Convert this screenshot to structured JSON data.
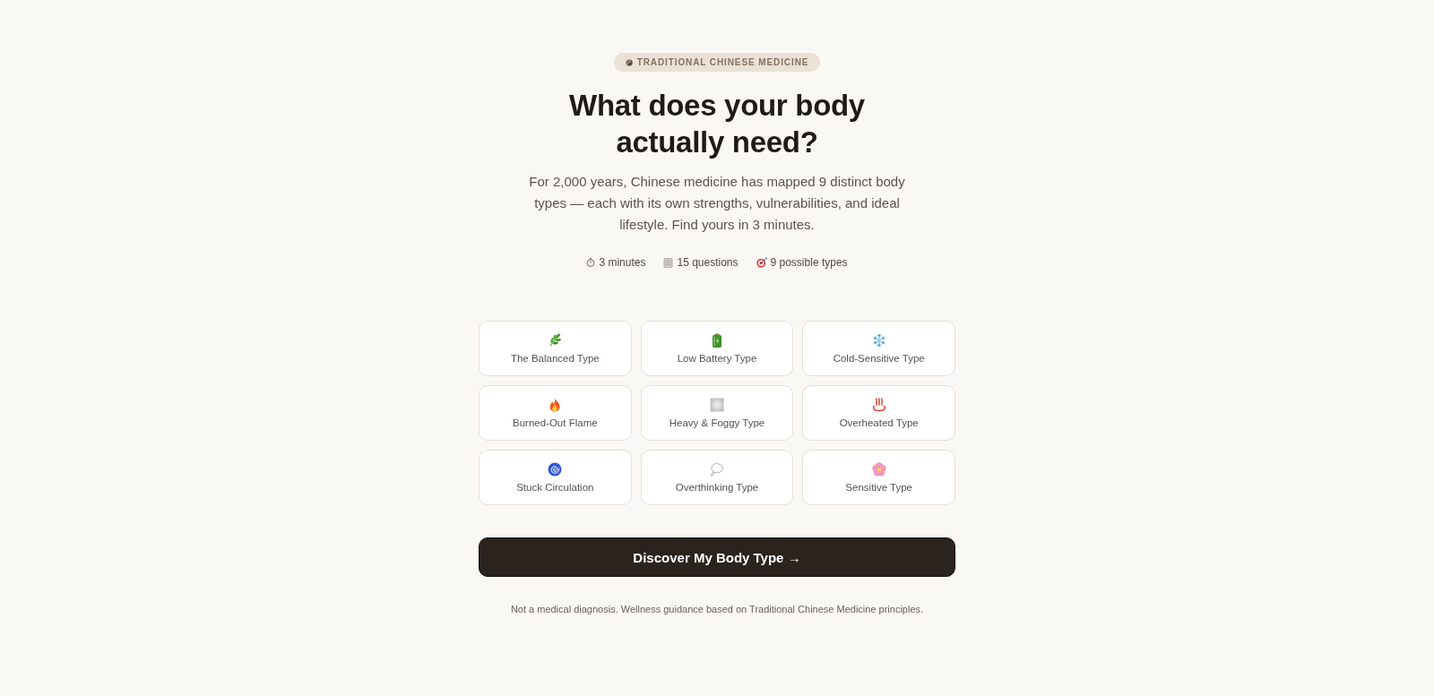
{
  "badge": {
    "label": "TRADITIONAL CHINESE MEDICINE"
  },
  "title": "What does your body actually need?",
  "intro": "For 2,000 years, Chinese medicine has mapped 9 distinct body types — each with its own strengths, vulnerabilities, and ideal lifestyle. Find yours in 3 minutes.",
  "meta": [
    "3 minutes",
    "15 questions",
    "9 possible types"
  ],
  "types": [
    "The Balanced Type",
    "Low Battery Type",
    "Cold-Sensitive Type",
    "Burned-Out Flame",
    "Heavy & Foggy Type",
    "Overheated Type",
    "Stuck Circulation",
    "Overthinking Type",
    "Sensitive Type"
  ],
  "cta": {
    "label": "Discover My Body Type →"
  },
  "disclaimer": "Not a medical diagnosis. Wellness guidance based on Traditional Chinese Medicine principles."
}
